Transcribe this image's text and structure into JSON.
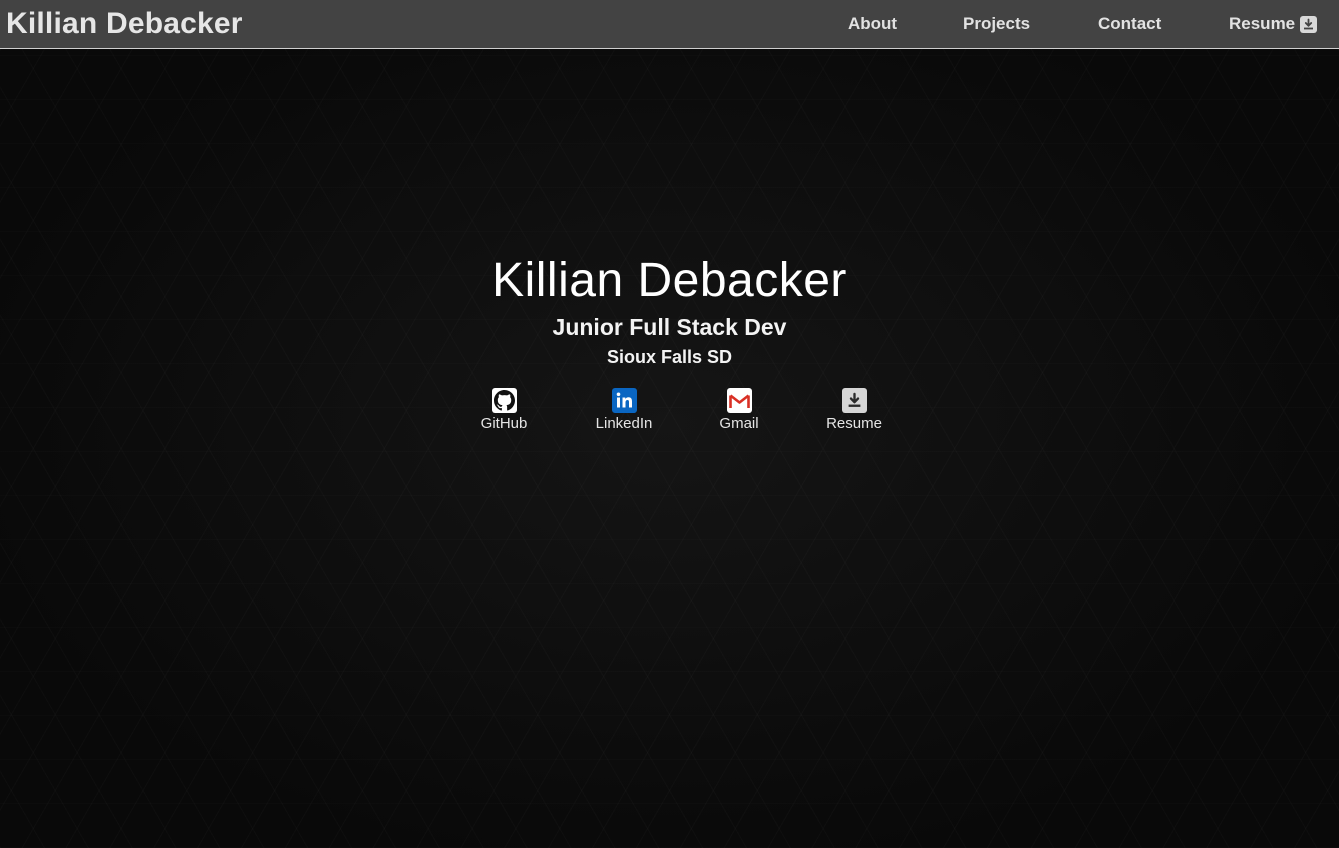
{
  "navbar": {
    "brand": "Killian Debacker",
    "links": [
      {
        "label": "About"
      },
      {
        "label": "Projects"
      },
      {
        "label": "Contact"
      },
      {
        "label": "Resume",
        "icon": "download-icon"
      }
    ]
  },
  "hero": {
    "name": "Killian Debacker",
    "role": "Junior Full Stack Dev",
    "location": "Sioux Falls SD"
  },
  "social_links": [
    {
      "label": "GitHub",
      "icon": "github-icon"
    },
    {
      "label": "LinkedIn",
      "icon": "linkedin-icon"
    },
    {
      "label": "Gmail",
      "icon": "gmail-icon"
    },
    {
      "label": "Resume",
      "icon": "download-icon"
    }
  ],
  "colors": {
    "navbar_bg": "#434343",
    "page_bg": "#0b0b0b",
    "linkedin_blue": "#0a66c2",
    "gmail_red": "#d93025"
  }
}
